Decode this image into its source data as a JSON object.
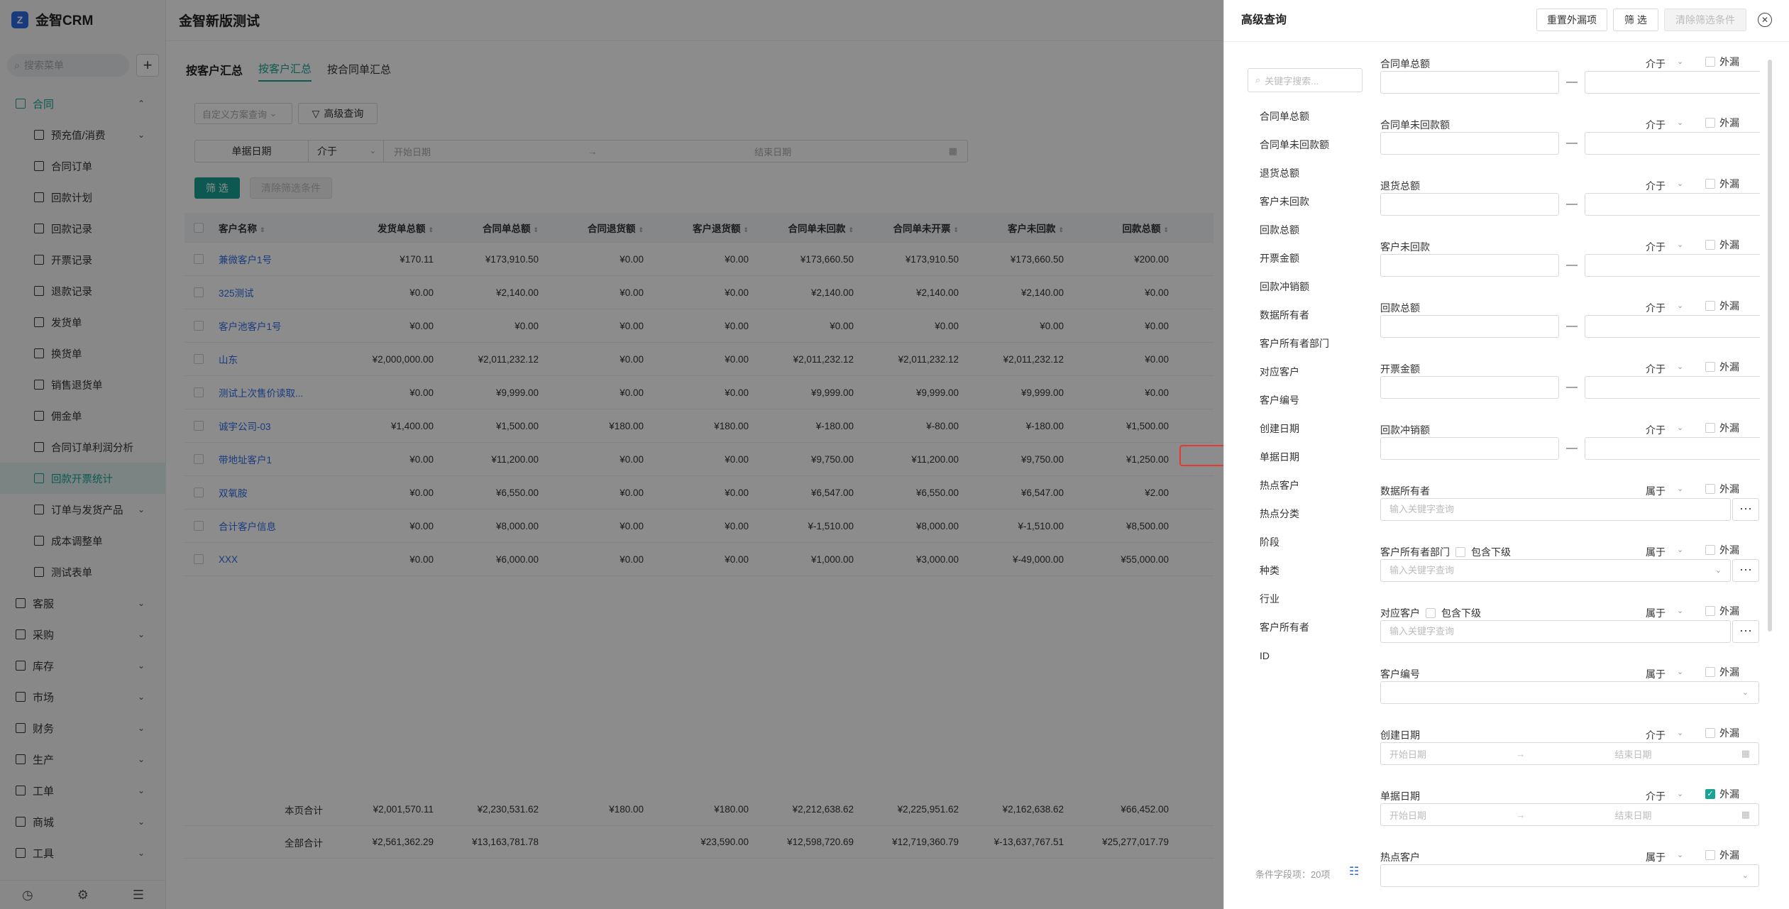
{
  "app": {
    "brand": "金智CRM",
    "page_title": "金智新版测试"
  },
  "sidebar": {
    "search_placeholder": "搜索菜单",
    "items": [
      {
        "label": "合同",
        "level": 0,
        "state": "open",
        "icon": "contract-icon"
      },
      {
        "label": "预充值/消费",
        "level": 1,
        "chevron": true,
        "icon": "wallet-icon"
      },
      {
        "label": "合同订单",
        "level": 1,
        "icon": "document-icon"
      },
      {
        "label": "回款计划",
        "level": 1,
        "icon": "plan-icon"
      },
      {
        "label": "回款记录",
        "level": 1,
        "icon": "record-icon"
      },
      {
        "label": "开票记录",
        "level": 1,
        "icon": "invoice-icon"
      },
      {
        "label": "退款记录",
        "level": 1,
        "icon": "refund-icon"
      },
      {
        "label": "发货单",
        "level": 1,
        "icon": "shipping-icon"
      },
      {
        "label": "换货单",
        "level": 1,
        "icon": "exchange-icon"
      },
      {
        "label": "销售退货单",
        "level": 1,
        "icon": "return-icon"
      },
      {
        "label": "佣金单",
        "level": 1,
        "icon": "commission-icon"
      },
      {
        "label": "合同订单利润分析",
        "level": 1,
        "icon": "analysis-icon"
      },
      {
        "label": "回款开票统计",
        "level": 1,
        "active": true,
        "icon": "stats-icon"
      },
      {
        "label": "订单与发货产品",
        "level": 1,
        "chevron": true,
        "icon": "product-icon"
      },
      {
        "label": "成本调整单",
        "level": 1,
        "icon": "cost-icon"
      },
      {
        "label": "测试表单",
        "level": 1,
        "icon": "form-icon"
      },
      {
        "label": "客服",
        "level": 0,
        "chevron": true,
        "icon": "service-icon"
      },
      {
        "label": "采购",
        "level": 0,
        "chevron": true,
        "icon": "purchase-icon"
      },
      {
        "label": "库存",
        "level": 0,
        "chevron": true,
        "icon": "inventory-icon"
      },
      {
        "label": "市场",
        "level": 0,
        "chevron": true,
        "icon": "market-icon"
      },
      {
        "label": "财务",
        "level": 0,
        "chevron": true,
        "icon": "finance-icon"
      },
      {
        "label": "生产",
        "level": 0,
        "chevron": true,
        "icon": "production-icon"
      },
      {
        "label": "工单",
        "level": 0,
        "chevron": true,
        "icon": "ticket-icon"
      },
      {
        "label": "商城",
        "level": 0,
        "chevron": true,
        "icon": "mall-icon"
      },
      {
        "label": "工具",
        "level": 0,
        "chevron": true,
        "icon": "tools-icon"
      }
    ]
  },
  "tabs": {
    "title": "按客户汇总",
    "items": [
      "按客户汇总",
      "按合同单汇总"
    ]
  },
  "toolbar": {
    "scheme_placeholder": "自定义方案查询",
    "advanced": "高级查询",
    "filter": "筛 选",
    "clear": "清除筛选条件"
  },
  "filter_row": {
    "field": "单据日期",
    "operator": "介于",
    "start": "开始日期",
    "end": "结束日期"
  },
  "table": {
    "columns": [
      "客户名称",
      "发货单总额",
      "合同单总额",
      "合同退货额",
      "客户退货额",
      "合同单未回款",
      "合同单未开票",
      "客户未回款",
      "回款总额"
    ],
    "rows": [
      [
        "兼微客户1号",
        "¥170.11",
        "¥173,910.50",
        "¥0.00",
        "¥0.00",
        "¥173,660.50",
        "¥173,910.50",
        "¥173,660.50",
        "¥200.00"
      ],
      [
        "325测试",
        "¥0.00",
        "¥2,140.00",
        "¥0.00",
        "¥0.00",
        "¥2,140.00",
        "¥2,140.00",
        "¥2,140.00",
        "¥0.00"
      ],
      [
        "客户池客户1号",
        "¥0.00",
        "¥0.00",
        "¥0.00",
        "¥0.00",
        "¥0.00",
        "¥0.00",
        "¥0.00",
        "¥0.00"
      ],
      [
        "山东",
        "¥2,000,000.00",
        "¥2,011,232.12",
        "¥0.00",
        "¥0.00",
        "¥2,011,232.12",
        "¥2,011,232.12",
        "¥2,011,232.12",
        "¥0.00"
      ],
      [
        "测试上次售价读取...",
        "¥0.00",
        "¥9,999.00",
        "¥0.00",
        "¥0.00",
        "¥9,999.00",
        "¥9,999.00",
        "¥9,999.00",
        "¥0.00"
      ],
      [
        "诚宇公司-03",
        "¥1,400.00",
        "¥1,500.00",
        "¥180.00",
        "¥180.00",
        "¥-180.00",
        "¥-80.00",
        "¥-180.00",
        "¥1,500.00"
      ],
      [
        "带地址客户1",
        "¥0.00",
        "¥11,200.00",
        "¥0.00",
        "¥0.00",
        "¥9,750.00",
        "¥11,200.00",
        "¥9,750.00",
        "¥1,250.00"
      ],
      [
        "双氧胺",
        "¥0.00",
        "¥6,550.00",
        "¥0.00",
        "¥0.00",
        "¥6,547.00",
        "¥6,550.00",
        "¥6,547.00",
        "¥2.00"
      ],
      [
        "合计客户信息",
        "¥0.00",
        "¥8,000.00",
        "¥0.00",
        "¥0.00",
        "¥-1,510.00",
        "¥8,000.00",
        "¥-1,510.00",
        "¥8,500.00"
      ],
      [
        "XXX",
        "¥0.00",
        "¥6,000.00",
        "¥0.00",
        "¥0.00",
        "¥1,000.00",
        "¥3,000.00",
        "¥-49,000.00",
        "¥55,000.00"
      ]
    ],
    "totals": [
      [
        "本页合计",
        "¥2,001,570.11",
        "¥2,230,531.62",
        "¥180.00",
        "¥180.00",
        "¥2,212,638.62",
        "¥2,225,951.62",
        "¥2,162,638.62",
        "¥66,452.00"
      ],
      [
        "全部合计",
        "¥2,561,362.29",
        "¥13,163,781.78",
        "",
        "¥23,590.00",
        "¥12,598,720.69",
        "¥12,719,360.79",
        "¥-13,637,767.51",
        "¥25,277,017.79"
      ]
    ]
  },
  "drawer": {
    "title": "高级查询",
    "reset": "重置外漏项",
    "filter": "筛 选",
    "clear": "清除筛选条件",
    "keyword_placeholder": "关键字搜索...",
    "fields": [
      "合同单总额",
      "合同单未回款额",
      "退货总额",
      "客户未回款",
      "回款总额",
      "开票金额",
      "回款冲销额",
      "数据所有者",
      "客户所有者部门",
      "对应客户",
      "客户编号",
      "创建日期",
      "单据日期",
      "热点客户",
      "热点分类",
      "阶段",
      "种类",
      "行业",
      "客户所有者",
      "ID"
    ],
    "highlighted_field": "单据日期",
    "condition_count": "条件字段项：20项",
    "ext_label": "外漏",
    "include_sub": "包含下级",
    "kw_placeholder": "输入关键字查询",
    "date_start": "开始日期",
    "date_end": "结束日期",
    "conditions": [
      {
        "label": "合同单总额",
        "op": "介于",
        "kind": "range"
      },
      {
        "label": "合同单未回款额",
        "op": "介于",
        "kind": "range"
      },
      {
        "label": "退货总额",
        "op": "介于",
        "kind": "range"
      },
      {
        "label": "客户未回款",
        "op": "介于",
        "kind": "range"
      },
      {
        "label": "回款总额",
        "op": "介于",
        "kind": "range"
      },
      {
        "label": "开票金额",
        "op": "介于",
        "kind": "range"
      },
      {
        "label": "回款冲销额",
        "op": "介于",
        "kind": "range"
      },
      {
        "label": "数据所有者",
        "op": "属于",
        "kind": "keyword"
      },
      {
        "label": "客户所有者部门",
        "op": "属于",
        "kind": "keyword-sub"
      },
      {
        "label": "对应客户",
        "op": "属于",
        "kind": "keyword-sub2"
      },
      {
        "label": "客户编号",
        "op": "属于",
        "kind": "select"
      },
      {
        "label": "创建日期",
        "op": "介于",
        "kind": "date"
      },
      {
        "label": "单据日期",
        "op": "介于",
        "kind": "date",
        "ext_checked": true
      },
      {
        "label": "热点客户",
        "op": "属于",
        "kind": "select"
      }
    ]
  }
}
